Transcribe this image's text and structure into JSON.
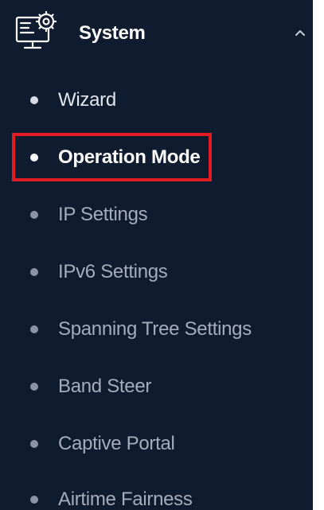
{
  "sidebar": {
    "section": {
      "title": "System",
      "icon": "monitor-settings-icon",
      "expanded": true
    },
    "items": [
      {
        "label": "Wizard",
        "state": "visited"
      },
      {
        "label": "Operation Mode",
        "state": "active"
      },
      {
        "label": "IP Settings",
        "state": "normal"
      },
      {
        "label": "IPv6 Settings",
        "state": "normal"
      },
      {
        "label": "Spanning Tree Settings",
        "state": "normal"
      },
      {
        "label": "Band Steer",
        "state": "normal"
      },
      {
        "label": "Captive Portal",
        "state": "normal"
      },
      {
        "label": "Airtime Fairness",
        "state": "normal"
      }
    ]
  },
  "colors": {
    "sidebar_bg": "#0f1b2e",
    "text_inactive": "#a5adbd",
    "text_active": "#ffffff",
    "highlight": "#e31b23"
  }
}
